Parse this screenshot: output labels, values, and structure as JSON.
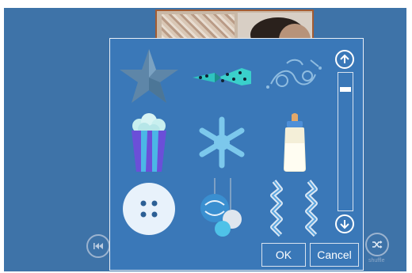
{
  "background": {
    "color": "#3e73a8"
  },
  "picker": {
    "stickers": [
      {
        "name": "star",
        "color": "#5e86a8"
      },
      {
        "name": "ribbon-bow",
        "color": "#2fc4c0"
      },
      {
        "name": "swirl-ornament",
        "color": "#7fb0d8"
      },
      {
        "name": "popcorn-box",
        "color": "#6b4fd8"
      },
      {
        "name": "snowflake",
        "color": "#6fc4ea"
      },
      {
        "name": "baby-bottle",
        "color": "#f4efd8"
      },
      {
        "name": "button",
        "color": "#e8f2fb"
      },
      {
        "name": "christmas-baubles",
        "color": "#3a8fd0"
      },
      {
        "name": "streamers",
        "color": "#dce8f4"
      }
    ],
    "scroll_up_icon": "arrow-up-icon",
    "scroll_down_icon": "arrow-down-icon",
    "scroll_position": 0.05,
    "ok_label": "OK",
    "cancel_label": "Cancel"
  },
  "controls": {
    "previous_icon": "skip-previous-icon",
    "shuffle_icon": "shuffle-icon",
    "shuffle_label": "shuffle"
  }
}
